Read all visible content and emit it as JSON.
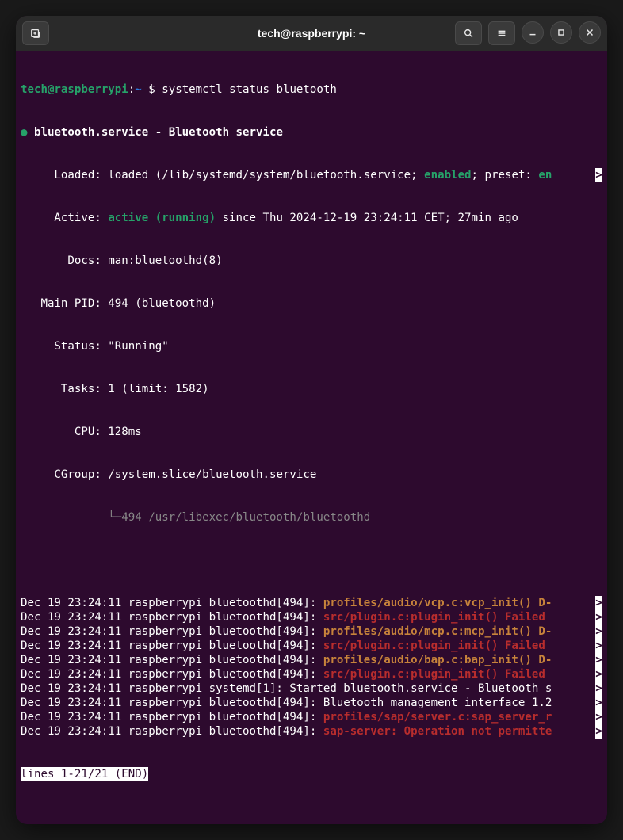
{
  "titlebar": {
    "title": "tech@raspberrypi: ~"
  },
  "prompt": {
    "user_host": "tech@raspberrypi",
    "colon": ":",
    "path": "~",
    "dollar": " $ ",
    "command": "systemctl status bluetooth"
  },
  "status": {
    "dot": "●",
    "service_line": " bluetooth.service - Bluetooth service",
    "loaded_label": "     Loaded: ",
    "loaded_body1": "loaded (",
    "loaded_path": "/lib/systemd/system/bluetooth.service",
    "loaded_body2": "; ",
    "loaded_enabled": "enabled",
    "loaded_body3": "; preset: ",
    "loaded_tail": "en",
    "active_label": "     Active: ",
    "active_state": "active (running)",
    "active_tail": " since Thu 2024-12-19 23:24:11 CET; 27min ago",
    "docs_label": "       Docs: ",
    "docs_link": "man:bluetoothd(8)",
    "mainpid": "   Main PID: 494 (bluetoothd)",
    "status_line": "     Status: \"Running\"",
    "tasks": "      Tasks: 1 (limit: 1582)",
    "cpu": "        CPU: 128ms",
    "cgroup_label": "     CGroup: ",
    "cgroup_path": "/system.slice/bluetooth.service",
    "cgroup_tree": "             └─494 /usr/libexec/bluetooth/bluetoothd"
  },
  "overflow": ">",
  "logs": [
    {
      "prefix": "Dec 19 23:24:11 raspberrypi bluetoothd[494]: ",
      "msg": "profiles/audio/vcp.c:vcp_init() D-",
      "cls": "c-orange",
      "ov": true
    },
    {
      "prefix": "Dec 19 23:24:11 raspberrypi bluetoothd[494]: ",
      "msg": "src/plugin.c:plugin_init() Failed ",
      "cls": "c-red",
      "ov": true
    },
    {
      "prefix": "Dec 19 23:24:11 raspberrypi bluetoothd[494]: ",
      "msg": "profiles/audio/mcp.c:mcp_init() D-",
      "cls": "c-orange",
      "ov": true
    },
    {
      "prefix": "Dec 19 23:24:11 raspberrypi bluetoothd[494]: ",
      "msg": "src/plugin.c:plugin_init() Failed ",
      "cls": "c-red",
      "ov": true
    },
    {
      "prefix": "Dec 19 23:24:11 raspberrypi bluetoothd[494]: ",
      "msg": "profiles/audio/bap.c:bap_init() D-",
      "cls": "c-orange",
      "ov": true
    },
    {
      "prefix": "Dec 19 23:24:11 raspberrypi bluetoothd[494]: ",
      "msg": "src/plugin.c:plugin_init() Failed ",
      "cls": "c-red",
      "ov": true
    },
    {
      "prefix": "Dec 19 23:24:11 raspberrypi systemd[1]: Started bluetooth.service - Bluetooth s",
      "msg": "",
      "cls": "",
      "ov": true
    },
    {
      "prefix": "Dec 19 23:24:11 raspberrypi bluetoothd[494]: Bluetooth management interface 1.2",
      "msg": "",
      "cls": "",
      "ov": true
    },
    {
      "prefix": "Dec 19 23:24:11 raspberrypi bluetoothd[494]: ",
      "msg": "profiles/sap/server.c:sap_server_r",
      "cls": "c-red",
      "ov": true
    },
    {
      "prefix": "Dec 19 23:24:11 raspberrypi bluetoothd[494]: ",
      "msg": "sap-server: Operation not permitte",
      "cls": "c-red",
      "ov": true
    }
  ],
  "pager": "lines 1-21/21 (END)"
}
